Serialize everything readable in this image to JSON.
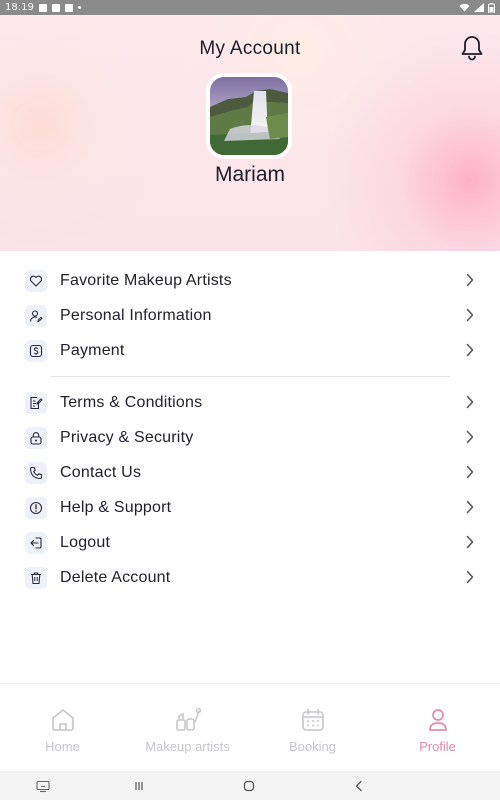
{
  "status_bar": {
    "time": "18:19"
  },
  "header": {
    "title": "My Account",
    "user_name": "Mariam"
  },
  "menu": {
    "group1": [
      {
        "label": "Favorite Makeup Artists",
        "icon": "heart-icon"
      },
      {
        "label": "Personal Information",
        "icon": "user-edit-icon"
      },
      {
        "label": "Payment",
        "icon": "dollar-icon"
      }
    ],
    "group2": [
      {
        "label": "Terms & Conditions",
        "icon": "document-edit-icon"
      },
      {
        "label": "Privacy & Security",
        "icon": "lock-icon"
      },
      {
        "label": "Contact Us",
        "icon": "phone-icon"
      },
      {
        "label": "Help & Support",
        "icon": "info-icon"
      },
      {
        "label": "Logout",
        "icon": "logout-icon"
      },
      {
        "label": "Delete Account",
        "icon": "trash-icon"
      }
    ]
  },
  "bottom_nav": [
    {
      "label": "Home",
      "icon": "home-icon",
      "active": false
    },
    {
      "label": "Makeup artists",
      "icon": "makeup-icon",
      "active": false
    },
    {
      "label": "Booking",
      "icon": "calendar-icon",
      "active": false
    },
    {
      "label": "Profile",
      "icon": "profile-icon",
      "active": true
    }
  ],
  "colors": {
    "accent": "#e98aa6",
    "inactive": "#c6c6cc",
    "icon_bg": "#eef0fa",
    "text": "#22222e"
  }
}
